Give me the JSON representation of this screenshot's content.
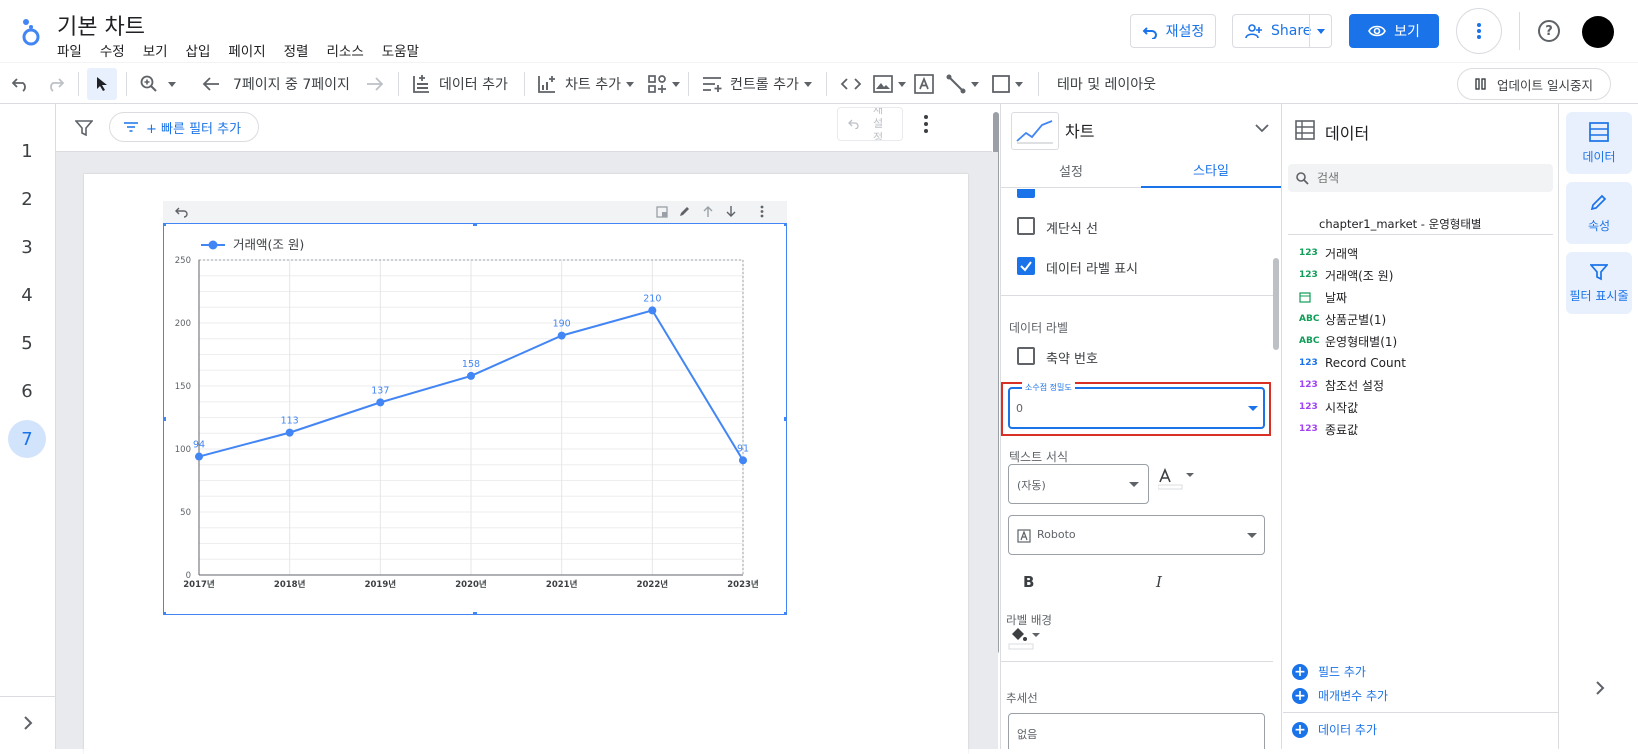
{
  "header": {
    "title": "기본 차트",
    "menu": [
      "파일",
      "수정",
      "보기",
      "삽입",
      "페이지",
      "정렬",
      "리소스",
      "도움말"
    ],
    "reset_label": "재설정",
    "share_label": "Share",
    "view_label": "보기"
  },
  "toolbar": {
    "page_nav": "7페이지 중 7페이지",
    "add_data": "데이터 추가",
    "add_chart": "차트 추가",
    "add_control": "컨트롤 추가",
    "theme_layout": "테마 및 레이아웃",
    "pause_updates": "업데이트 일시중지"
  },
  "pages": [
    "1",
    "2",
    "3",
    "4",
    "5",
    "6",
    "7"
  ],
  "active_page": "7",
  "filterbar": {
    "quick_filter": "+ 빠른 필터 추가",
    "reset": "재설정"
  },
  "chart_data": {
    "type": "line",
    "categories": [
      "2017년",
      "2018년",
      "2019년",
      "2020년",
      "2021년",
      "2022년",
      "2023년"
    ],
    "series": [
      {
        "name": "거래액(조 원)",
        "values": [
          94,
          113,
          137,
          158,
          190,
          210,
          91
        ],
        "color": "#4285f4"
      }
    ],
    "ylim": [
      0,
      250
    ],
    "yticks": [
      0,
      50,
      100,
      150,
      200,
      250
    ],
    "grid": true,
    "legend": "top-left",
    "data_labels": true
  },
  "properties": {
    "panel_title": "차트",
    "tabs": [
      "설정",
      "스타일"
    ],
    "active_tab": "스타일",
    "step_line": "계단식 선",
    "show_data_labels": "데이터 라벨 표시",
    "data_label_section": "데이터 라벨",
    "compact_numbers": "축약 번호",
    "decimal_precision_label": "소수점 정밀도",
    "decimal_precision_value": "0",
    "text_format": "텍스트 서식",
    "font_size_value": "(자동)",
    "font_family_value": "Roboto",
    "label_background": "라벨 배경",
    "trendline": "추세선",
    "trendline_value": "없음"
  },
  "data_panel": {
    "title": "데이터",
    "search_placeholder": "검색",
    "source": "chapter1_market - 운영형태별",
    "fields": [
      {
        "type": "123",
        "name": "거래액"
      },
      {
        "type": "123",
        "name": "거래액(조 원)"
      },
      {
        "type": "date",
        "name": "날짜"
      },
      {
        "type": "ABC",
        "name": "상품군별(1)"
      },
      {
        "type": "ABC",
        "name": "운영형태별(1)"
      },
      {
        "type": "123",
        "name": "Record Count"
      },
      {
        "type": "123",
        "name": "참조선 설정"
      },
      {
        "type": "123",
        "name": "시작값"
      },
      {
        "type": "123",
        "name": "종료값"
      }
    ],
    "add_field": "필드 추가",
    "add_parameter": "매개변수 추가",
    "add_data": "데이터 추가"
  },
  "rail": {
    "data": "데이터",
    "properties": "속성",
    "filter": "필터 표시줄"
  },
  "colors": {
    "accent": "#1a73e8",
    "series": "#4285f4",
    "highlight": "#d93025"
  }
}
